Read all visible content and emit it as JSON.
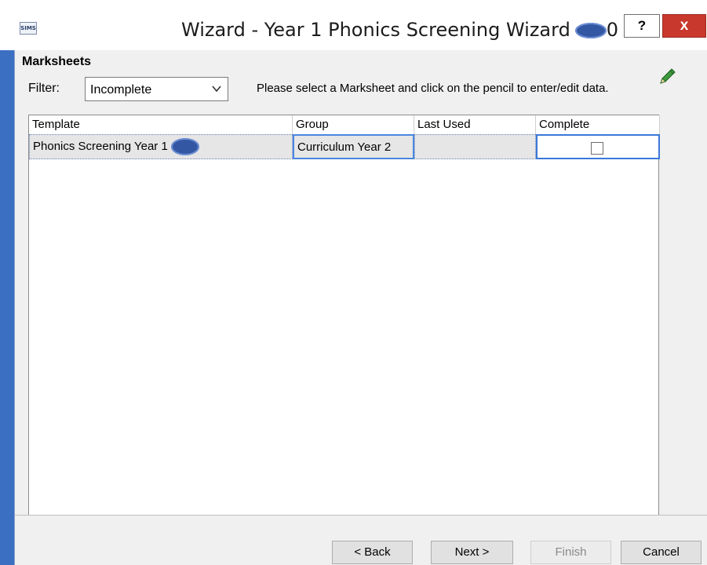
{
  "window": {
    "title": "Wizard - Year 1 Phonics Screening Wizard",
    "title_suffix": "0",
    "app_icon_text": "SIMS",
    "help_label": "?",
    "close_label": "x"
  },
  "section_title": "Marksheets",
  "filter": {
    "label": "Filter:",
    "selected": "Incomplete"
  },
  "instructions": "Please select a Marksheet and click on the pencil to enter/edit data.",
  "grid": {
    "columns": [
      "Template",
      "Group",
      "Last Used",
      "Complete"
    ],
    "rows": [
      {
        "template": "Phonics Screening Year 1",
        "group": "Curriculum Year  2",
        "last_used": "",
        "complete": false
      }
    ]
  },
  "buttons": {
    "back": "< Back",
    "next": "Next >",
    "finish": "Finish",
    "cancel": "Cancel"
  },
  "colors": {
    "frame": "#3a6fc2",
    "close": "#c8382c",
    "selection_border": "#4a86e0",
    "pencil": "#3c9a3c"
  },
  "icons": {
    "edit": "pencil-icon",
    "dropdown": "chevron-down-icon"
  }
}
